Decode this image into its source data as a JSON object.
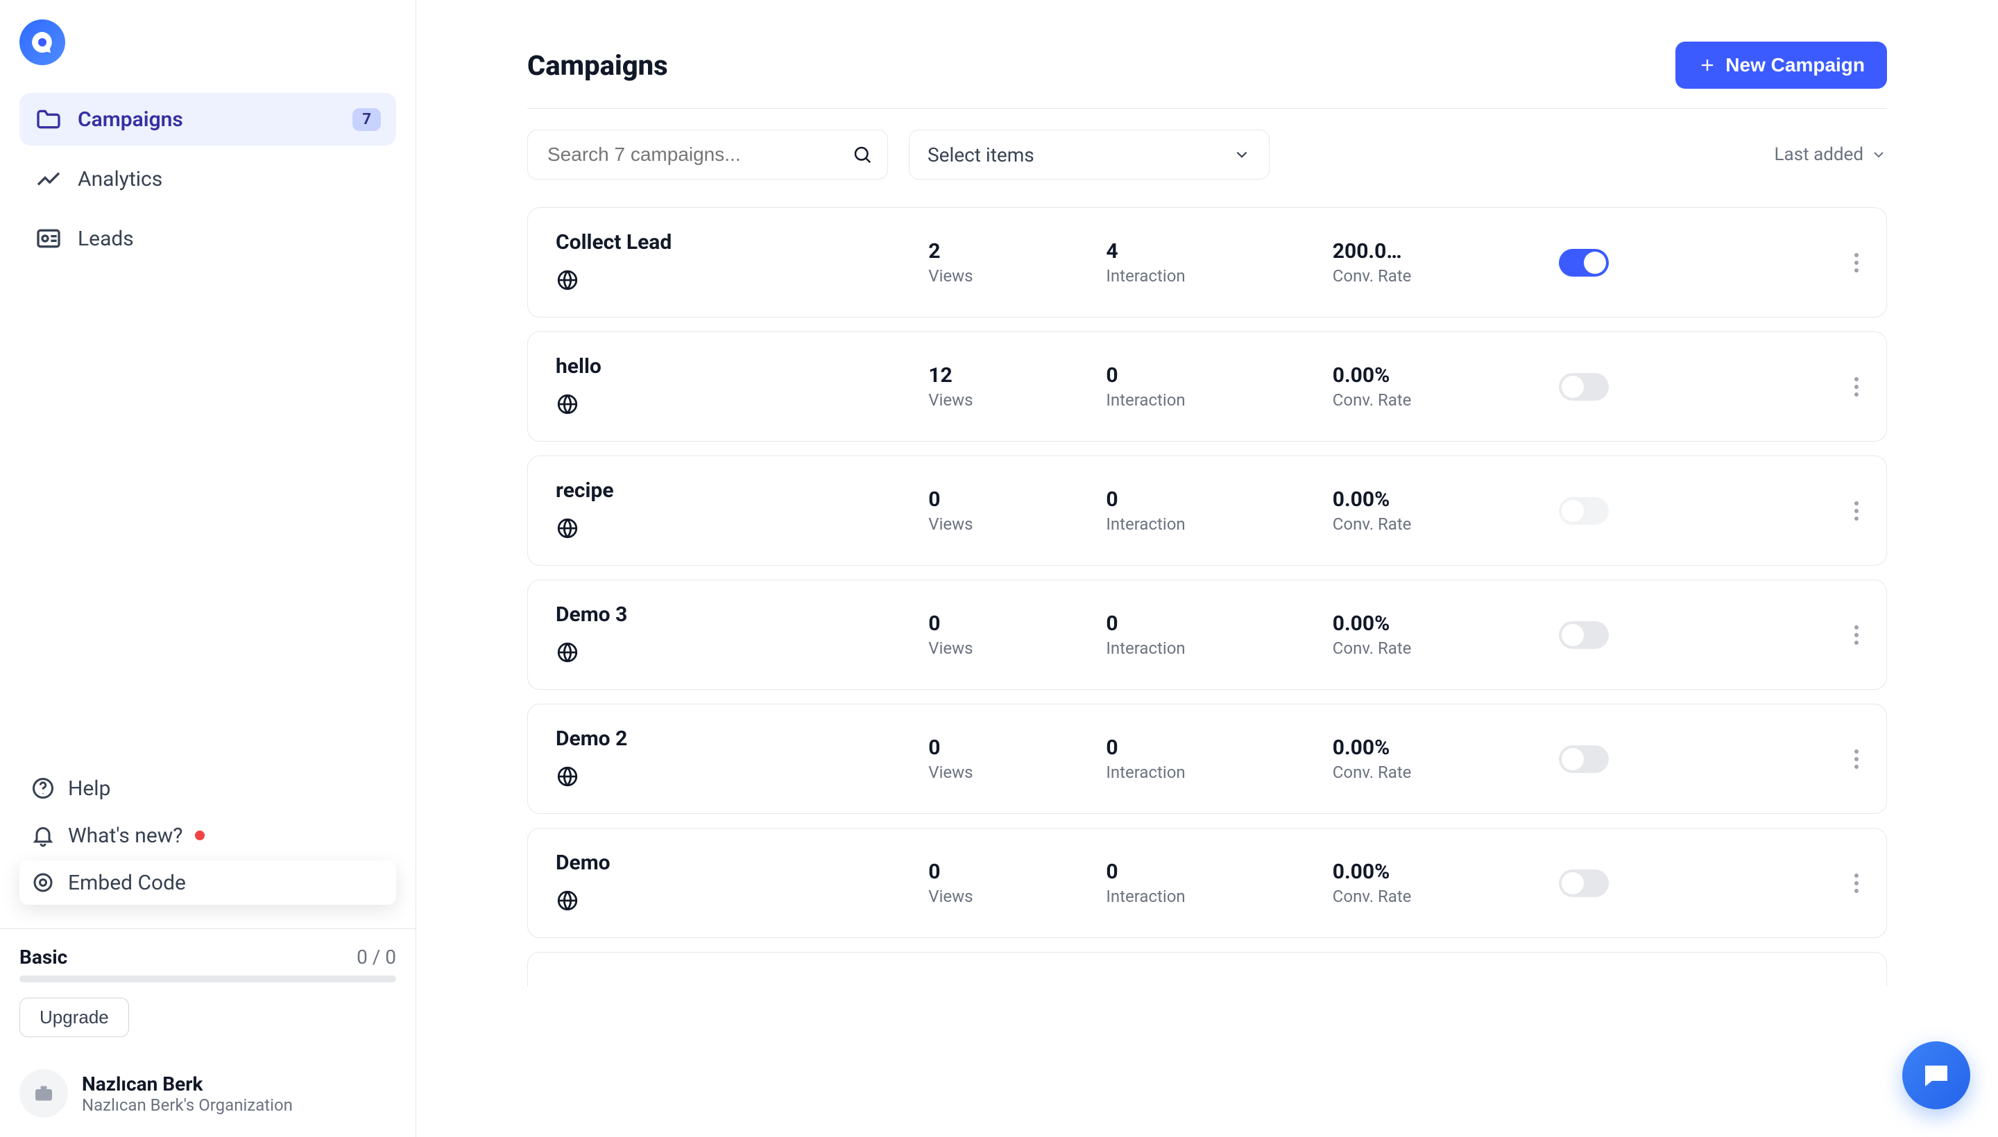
{
  "brand": {
    "accent": "#3b5bff"
  },
  "sidebar": {
    "items": [
      {
        "label": "Campaigns",
        "badge": "7"
      },
      {
        "label": "Analytics"
      },
      {
        "label": "Leads"
      }
    ],
    "lower": {
      "help": "Help",
      "whatsnew": "What's new?",
      "embed": "Embed Code"
    }
  },
  "plan": {
    "name": "Basic",
    "usage": "0 / 0",
    "upgrade": "Upgrade"
  },
  "user": {
    "name": "Nazlıcan Berk",
    "org": "Nazlıcan Berk's Organization"
  },
  "header": {
    "title": "Campaigns",
    "new_btn": "New Campaign"
  },
  "toolbar": {
    "search_placeholder": "Search 7 campaigns...",
    "select_label": "Select items",
    "sort_label": "Last added"
  },
  "columns": {
    "views": "Views",
    "interaction": "Interaction",
    "conv": "Conv. Rate"
  },
  "campaigns": [
    {
      "name": "Collect Lead",
      "views": "2",
      "interaction": "4",
      "conv": "200.0…",
      "active": true,
      "disabled": false
    },
    {
      "name": "hello",
      "views": "12",
      "interaction": "0",
      "conv": "0.00%",
      "active": false,
      "disabled": false
    },
    {
      "name": "recipe",
      "views": "0",
      "interaction": "0",
      "conv": "0.00%",
      "active": false,
      "disabled": true
    },
    {
      "name": "Demo 3",
      "views": "0",
      "interaction": "0",
      "conv": "0.00%",
      "active": false,
      "disabled": false
    },
    {
      "name": "Demo 2",
      "views": "0",
      "interaction": "0",
      "conv": "0.00%",
      "active": false,
      "disabled": false
    },
    {
      "name": "Demo",
      "views": "0",
      "interaction": "0",
      "conv": "0.00%",
      "active": false,
      "disabled": false
    }
  ]
}
